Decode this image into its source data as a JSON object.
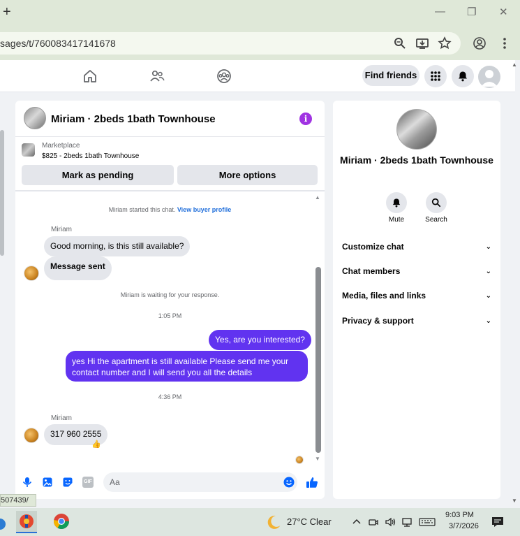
{
  "browser": {
    "new_tab_glyph": "+",
    "minimize_glyph": "—",
    "restore_glyph": "❐",
    "close_glyph": "✕",
    "url": "sages/t/760083417141678",
    "status_url": "507439/"
  },
  "fb_nav": {
    "find_friends": "Find friends"
  },
  "chat": {
    "title": "Miriam · 2beds 1bath Townhouse",
    "info_glyph": "i",
    "marketplace_label": "Marketplace",
    "marketplace_item": "$825 - 2beds 1bath Townhouse",
    "mark_pending": "Mark as pending",
    "more_options": "More options",
    "started_text": "Miriam started this chat.",
    "view_buyer_profile": "View buyer profile",
    "sender_1": "Miriam",
    "msg_1": "Good morning, is this still available?",
    "msg_2": "Message sent",
    "waiting_text": "Miriam is waiting for your response.",
    "time_1": "1:05 PM",
    "out_1": "Yes, are you interested?",
    "out_2": "yes Hi the apartment is still available Please send me your contact number and I will send you all the details",
    "time_2": "4:36 PM",
    "sender_2": "Miriam",
    "msg_3": "317 960 2555",
    "reaction": "👍",
    "composer_placeholder": "Aa",
    "gif_label": "GIF"
  },
  "info_panel": {
    "name": "Miriam · 2beds 1bath Townhouse",
    "mute": "Mute",
    "search": "Search",
    "rows": [
      "Customize chat",
      "Chat members",
      "Media, files and links",
      "Privacy & support"
    ],
    "chevron": "⌄"
  },
  "taskbar": {
    "weather": "27°C  Clear",
    "time": "9:03 PM",
    "date": "3/7/2026"
  },
  "colors": {
    "accent_purple": "#6133f0",
    "info_purple": "#a033e2",
    "fb_blue": "#0866ff",
    "link_blue": "#216fdb"
  }
}
